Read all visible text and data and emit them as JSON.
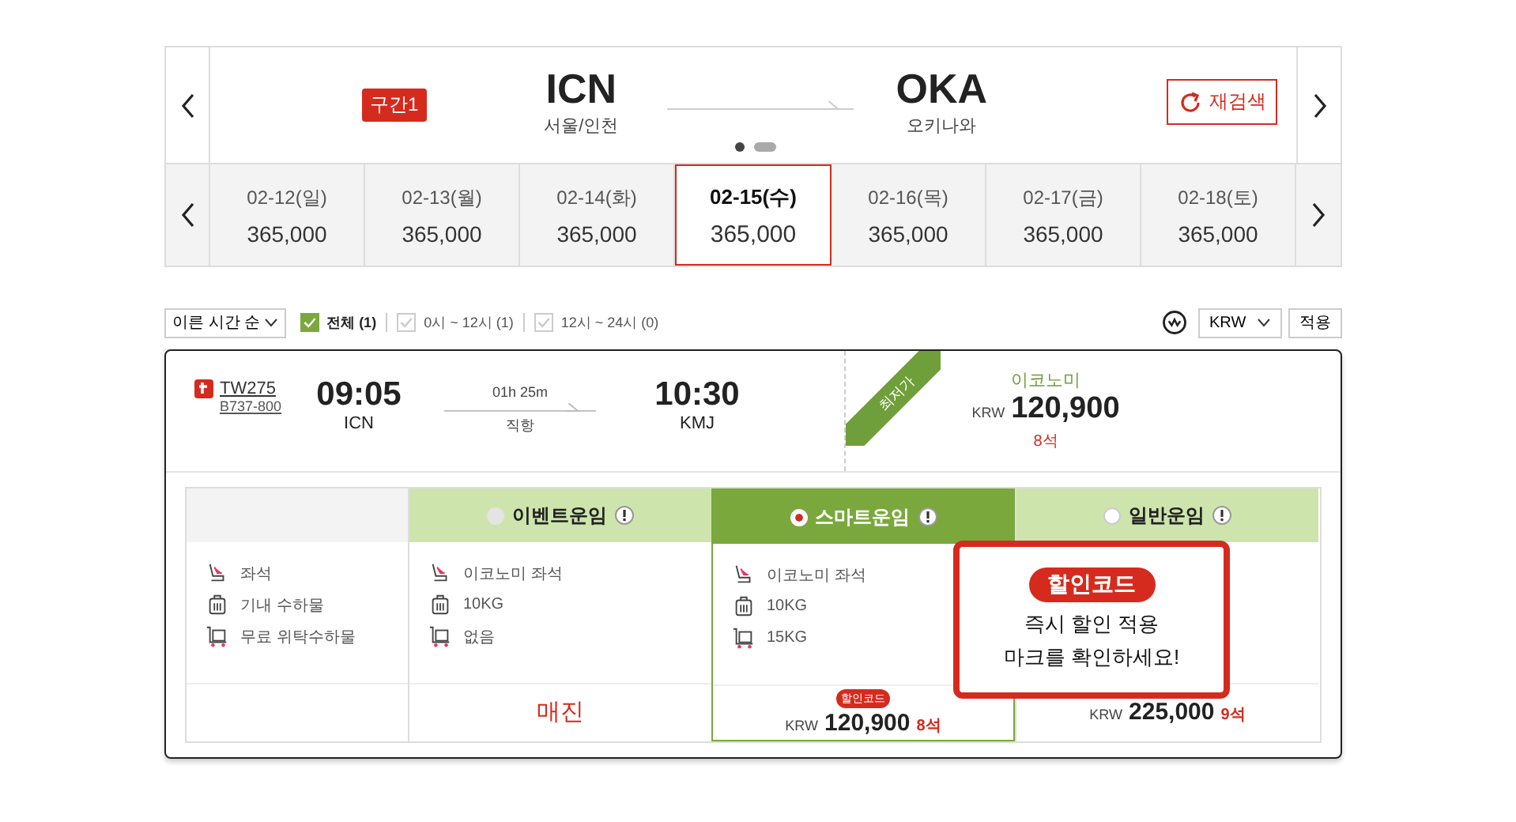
{
  "route": {
    "segment_badge": "구간1",
    "from": {
      "code": "ICN",
      "city": "서울/인천"
    },
    "to": {
      "code": "OKA",
      "city": "오키나와"
    },
    "research_button": "재검색",
    "pages": [
      {
        "selected": true
      },
      {
        "selected": false
      }
    ]
  },
  "dates": [
    {
      "date": "02-12(일)",
      "price": "365,000",
      "selected": false
    },
    {
      "date": "02-13(월)",
      "price": "365,000",
      "selected": false
    },
    {
      "date": "02-14(화)",
      "price": "365,000",
      "selected": false
    },
    {
      "date": "02-15(수)",
      "price": "365,000",
      "selected": true
    },
    {
      "date": "02-16(목)",
      "price": "365,000",
      "selected": false
    },
    {
      "date": "02-17(금)",
      "price": "365,000",
      "selected": false
    },
    {
      "date": "02-18(토)",
      "price": "365,000",
      "selected": false
    }
  ],
  "filters": {
    "sort": "이른 시간 순",
    "checkboxes": [
      {
        "label": "전체 (1)",
        "checked": true
      },
      {
        "label": "0시 ~ 12시 (1)",
        "checked": false
      },
      {
        "label": "12시 ~ 24시 (0)",
        "checked": false
      }
    ],
    "currency": "KRW",
    "apply_button": "적용"
  },
  "flight": {
    "flight_no": "TW275",
    "aircraft": "B737-800",
    "dep_time": "09:05",
    "dep_airport": "ICN",
    "duration": "01h 25m",
    "route_type": "직항",
    "arr_time": "10:30",
    "arr_airport": "KMJ",
    "ribbon": "최저가",
    "cabin": "이코노미",
    "currency": "KRW",
    "price": "120,900",
    "seats": "8석"
  },
  "fare_table": {
    "labels": [
      {
        "kind": "seat",
        "text": "좌석"
      },
      {
        "kind": "bag",
        "text": "기내 수하물"
      },
      {
        "kind": "cart",
        "text": "무료 위탁수하물"
      }
    ],
    "fares": [
      {
        "name": "이벤트운임",
        "selected": false,
        "features": [
          {
            "kind": "seat",
            "text": "이코노미 좌석"
          },
          {
            "kind": "bag",
            "text": "10KG"
          },
          {
            "kind": "cart",
            "text": "없음"
          }
        ],
        "kind": "sold_out",
        "status": "매진"
      },
      {
        "name": "스마트운임",
        "selected": true,
        "features": [
          {
            "kind": "seat",
            "text": "이코노미 좌석"
          },
          {
            "kind": "bag",
            "text": "10KG"
          },
          {
            "kind": "cart",
            "text": "15KG"
          }
        ],
        "kind": "price",
        "badge": "할인코드",
        "currency": "KRW",
        "price": "120,900",
        "seats": "8석"
      },
      {
        "name": "일반운임",
        "selected": false,
        "kind": "price",
        "currency": "KRW",
        "price": "225,000",
        "seats": "9석"
      }
    ]
  },
  "callout": {
    "badge": "할인코드",
    "lines": [
      "즉시 할인 적용",
      "마크를 확인하세요!"
    ]
  }
}
